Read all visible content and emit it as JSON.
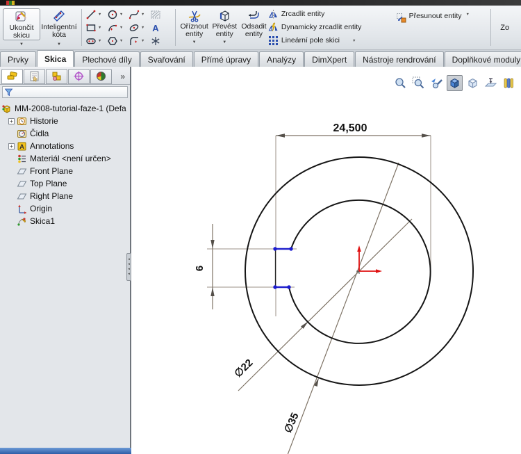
{
  "glyphs": {
    "dropdown": "▼",
    "chevron": "▾",
    "expand": "»",
    "plus": "+",
    "text_tool": "A",
    "splitter_arrow": "◂"
  },
  "ribbon": {
    "exit_sketch": {
      "line1": "Ukončit",
      "line2": "skicu"
    },
    "smart_dimension": {
      "line1": "Inteligentní",
      "line2": "kóta"
    },
    "trim": {
      "line1": "Oříznout",
      "line2": "entity"
    },
    "convert": {
      "line1": "Převést",
      "line2": "entity"
    },
    "offset": {
      "line1": "Odsadit",
      "line2": "entity"
    },
    "mirror": {
      "label": "Zrcadlit entity"
    },
    "dynamic_mirror": {
      "label": "Dynamicky zrcadlit entity"
    },
    "linear_pattern": {
      "label": "Lineární pole skici"
    },
    "move": {
      "label": "Přesunout entity"
    },
    "zoom_group_partial": {
      "label": "Zo"
    }
  },
  "tabs": {
    "items": [
      "Prvky",
      "Skica",
      "Plechové díly",
      "Svařování",
      "Přímé úpravy",
      "Analýzy",
      "DimXpert",
      "Nástroje rendrování",
      "Doplňkové moduly SOLIDWO"
    ],
    "active": "Skica"
  },
  "sidebar": {
    "root_label": "MM-2008-tutorial-faze-1  (Defa",
    "items": [
      "Historie",
      "Čidla",
      "Annotations",
      "Materiál <není určen>",
      "Front Plane",
      "Top Plane",
      "Right Plane",
      "Origin",
      "Skica1"
    ]
  },
  "sketch": {
    "dim_width": "24,500",
    "dim_keyway_height": "6",
    "dim_inner_diameter": "∅22",
    "dim_outer_diameter": "∅35"
  },
  "colors": {
    "sketch_blue": "#2222cc",
    "origin_red": "#e01212",
    "dimension_line": "#7d7264",
    "status_blue": "#2d5da8"
  }
}
